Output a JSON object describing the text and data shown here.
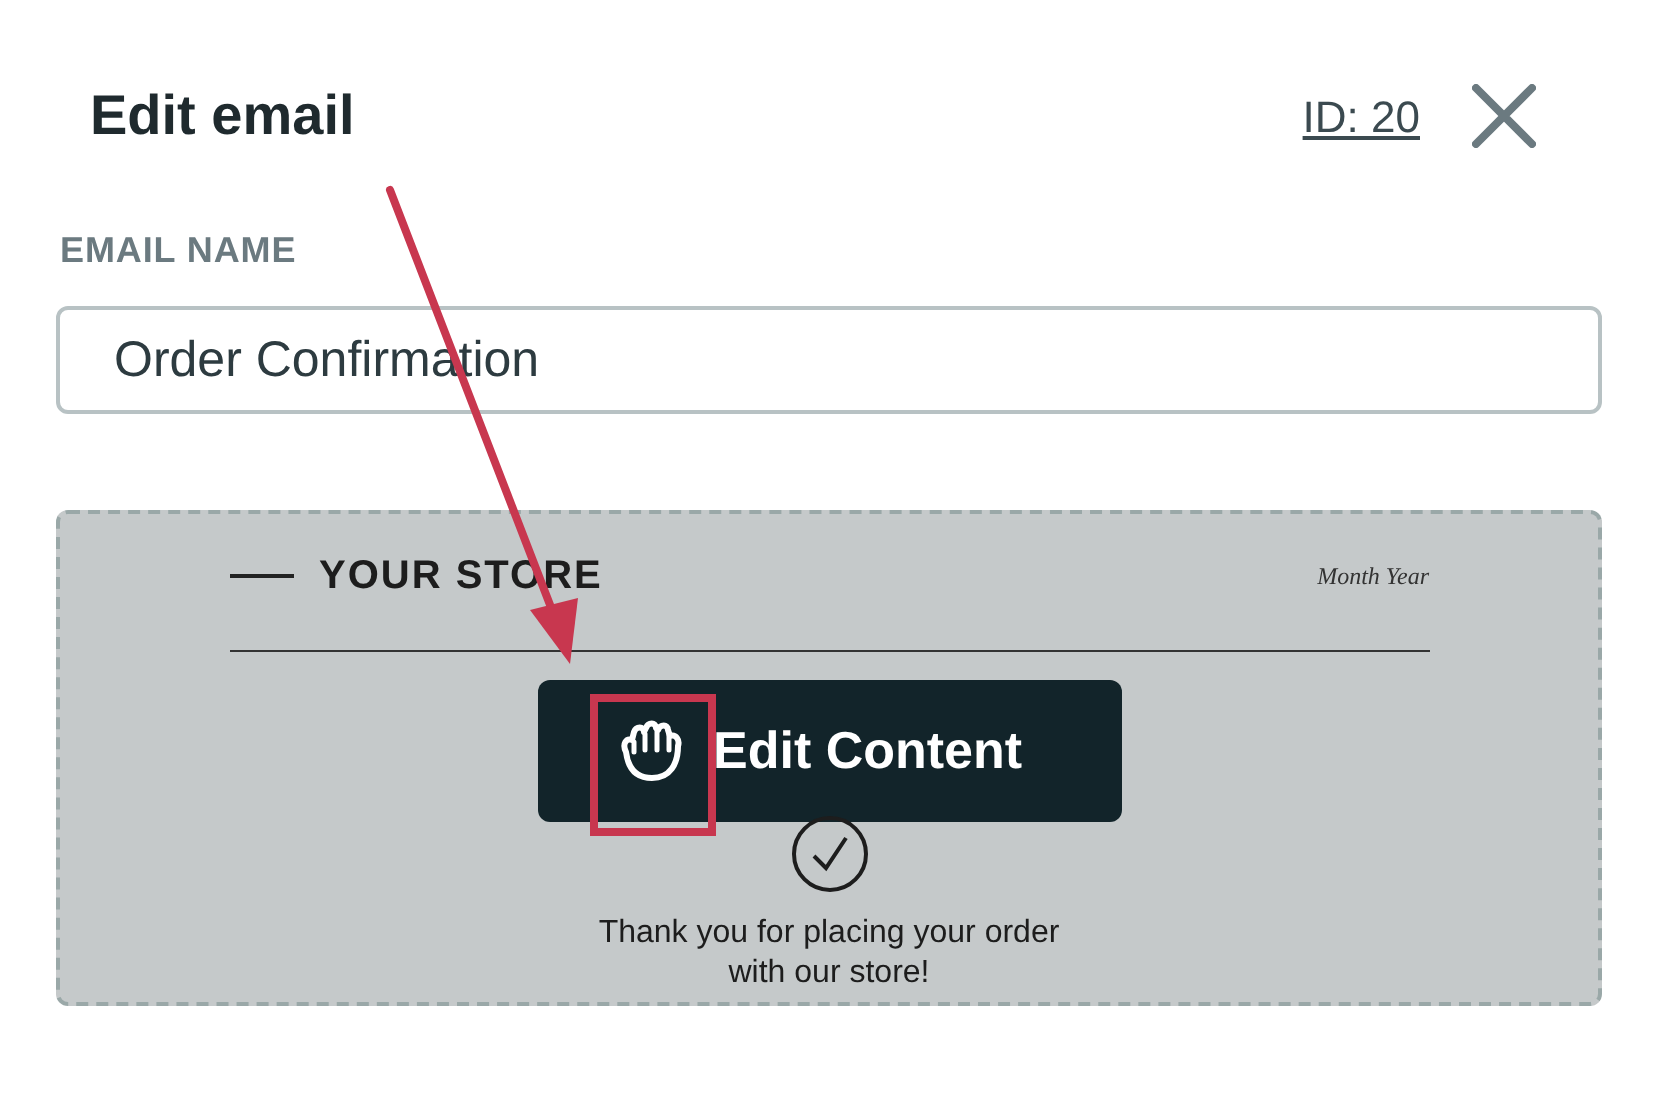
{
  "header": {
    "title": "Edit email",
    "id_link": "ID: 20"
  },
  "email_name": {
    "label": "EMAIL NAME",
    "value": "Order Confirmation"
  },
  "preview": {
    "store_name": "YOUR STORE",
    "date": "Month Year",
    "edit_button": "Edit Content",
    "message": "Thank you for placing your order with our store!"
  }
}
